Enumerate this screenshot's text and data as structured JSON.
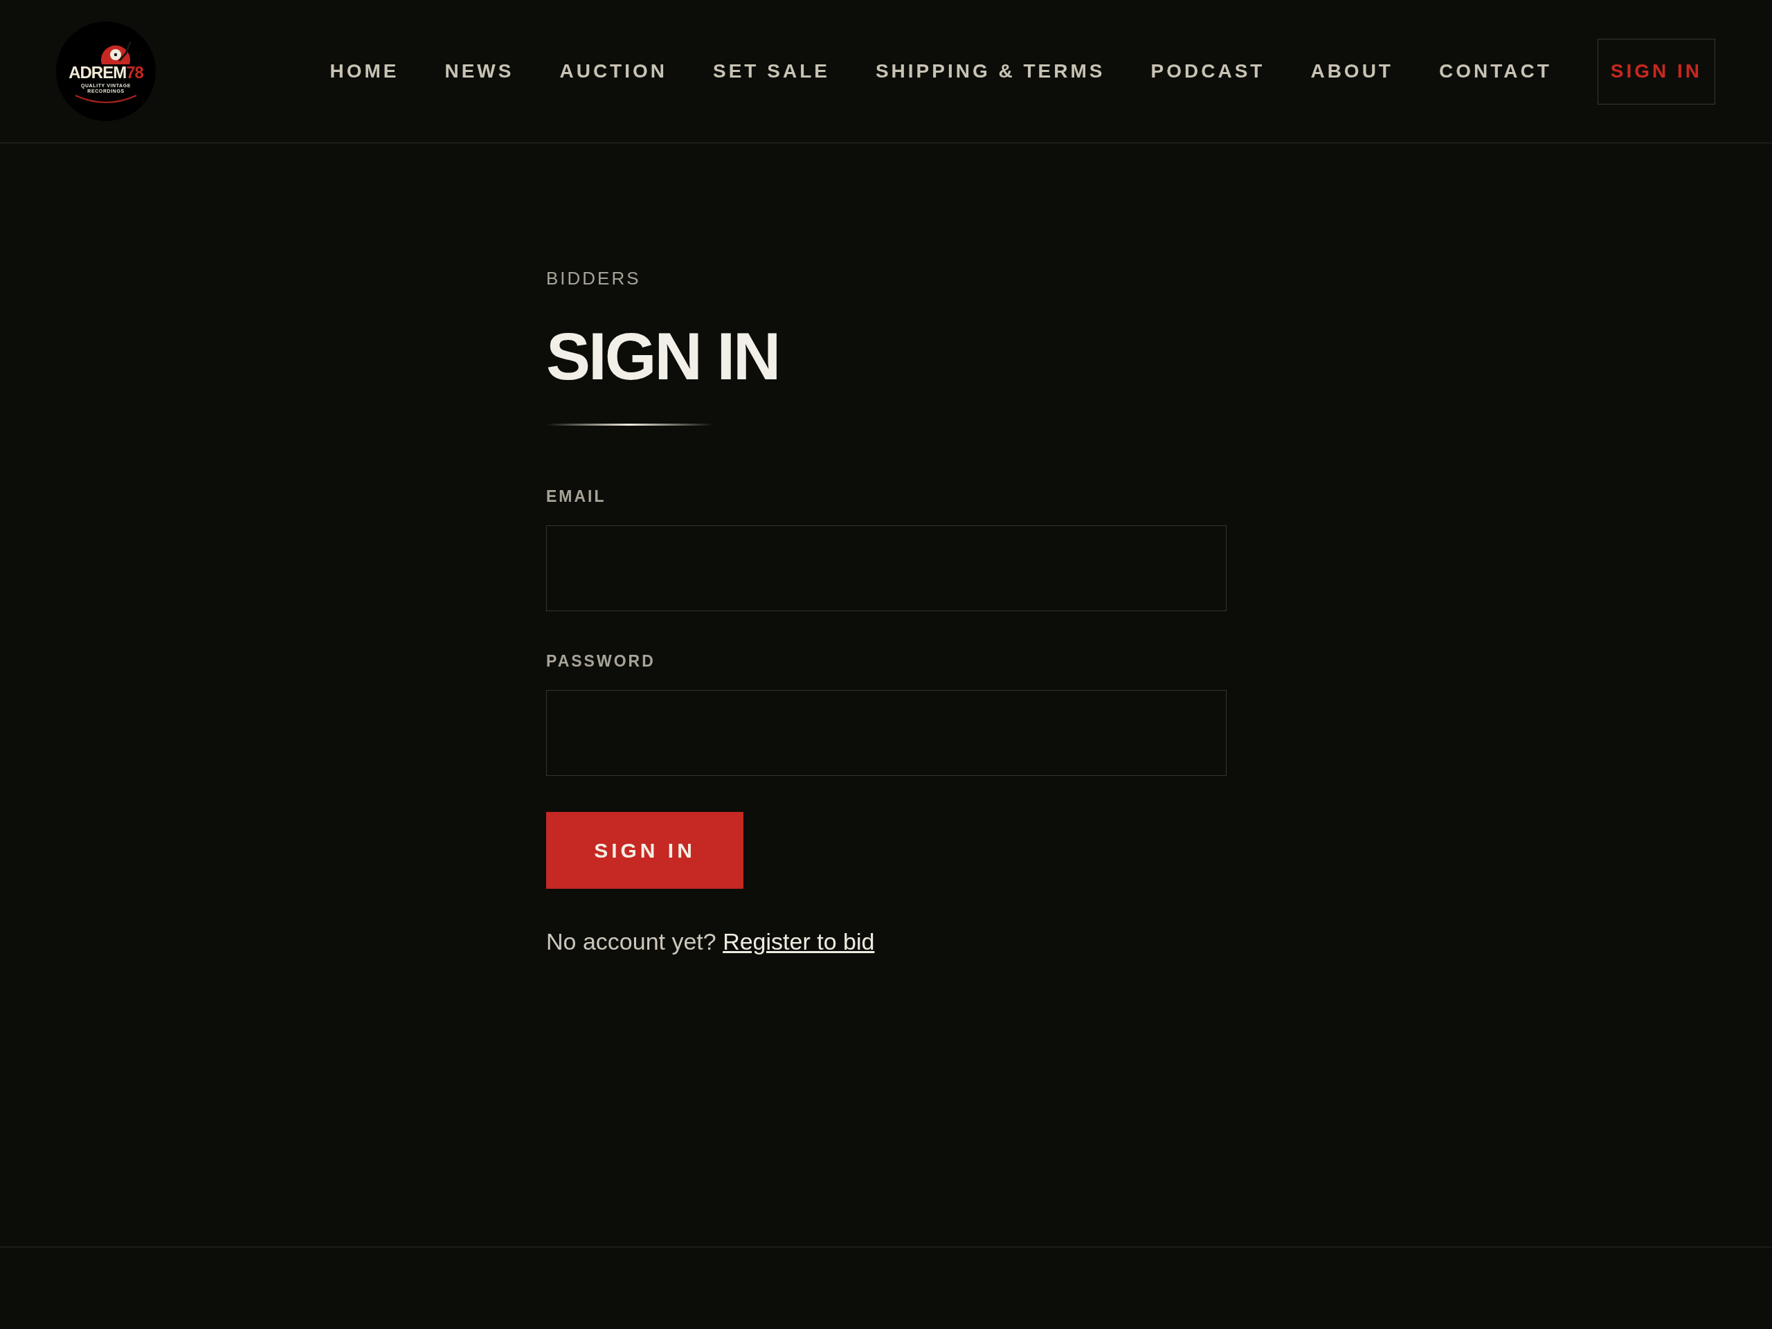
{
  "header": {
    "logo": {
      "wordmark": "ADREM",
      "wordmark_accent": "78",
      "tagline": [
        "QUALITY VINTAGE",
        "RECORDINGS"
      ]
    },
    "nav": [
      "HOME",
      "NEWS",
      "AUCTION",
      "SET SALE",
      "SHIPPING & TERMS",
      "PODCAST",
      "ABOUT",
      "CONTACT"
    ],
    "sign_in_button": "SIGN IN"
  },
  "sign_in": {
    "eyebrow": "BIDDERS",
    "title": "SIGN IN",
    "fields": [
      {
        "label": "EMAIL"
      },
      {
        "label": "PASSWORD"
      }
    ],
    "submit_button": "SIGN IN",
    "register_prompt": {
      "text": "No account yet?",
      "link": "Register to bid"
    }
  }
}
